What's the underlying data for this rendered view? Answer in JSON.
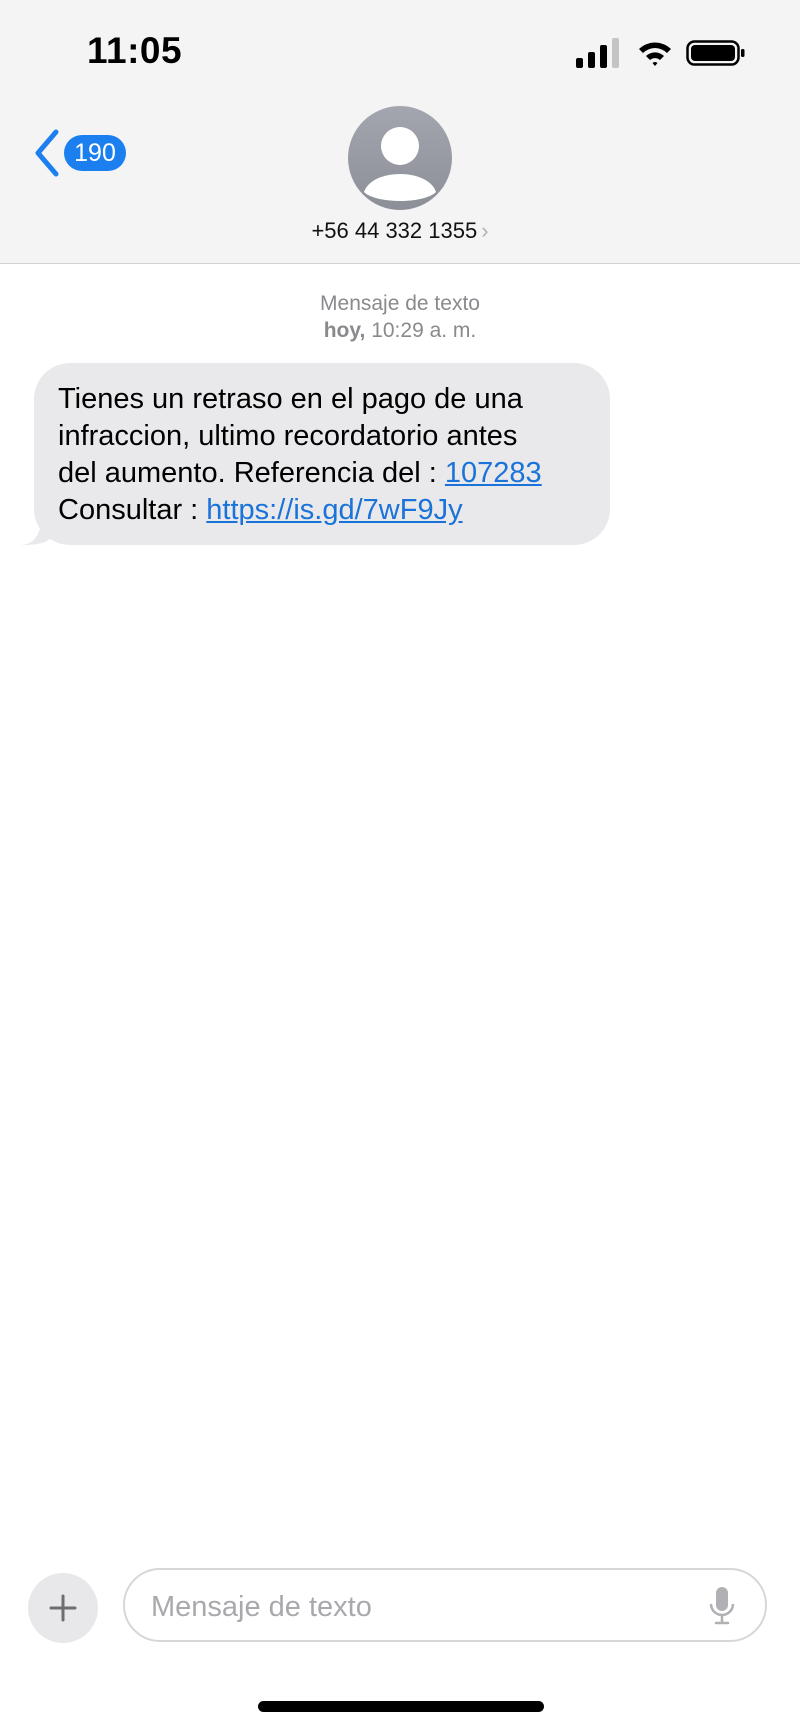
{
  "status_bar": {
    "time": "11:05",
    "icons": [
      "cellular-signal-icon",
      "wifi-icon",
      "battery-icon"
    ]
  },
  "nav": {
    "back_badge_count": "190",
    "contact_number": "+56 44 332 1355",
    "contact_chevron": "›"
  },
  "conversation": {
    "service_label": "Mensaje de texto",
    "timestamp_day": "hoy,",
    "timestamp_time": " 10:29 a. m.",
    "message": {
      "line1": "Tienes un retraso en el pago de una",
      "line2": "infraccion, ultimo recordatorio antes",
      "line3_prefix": "del aumento. Referencia del : ",
      "reference_link": "107283",
      "line4_prefix": "Consultar : ",
      "url_link": "https://is.gd/7wF9Jy"
    }
  },
  "composer": {
    "placeholder": "Mensaje de texto",
    "add_symbol": "+"
  },
  "colors": {
    "accent": "#1b7ff0",
    "bubble_incoming": "#e9e9eb",
    "link": "#1a73d9",
    "header_bg": "#f4f4f4"
  }
}
